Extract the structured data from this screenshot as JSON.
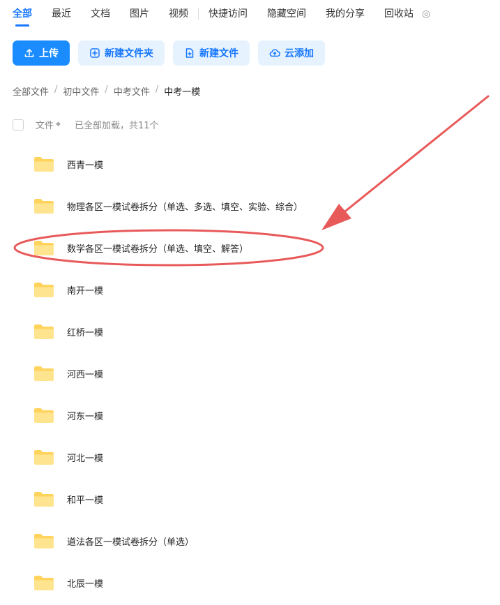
{
  "tabs": [
    {
      "label": "全部"
    },
    {
      "label": "最近"
    },
    {
      "label": "文档"
    },
    {
      "label": "图片"
    },
    {
      "label": "视频"
    },
    {
      "label": "快捷访问"
    },
    {
      "label": "隐藏空间"
    },
    {
      "label": "我的分享"
    },
    {
      "label": "回收站"
    }
  ],
  "toolbar": {
    "upload_label": "上传",
    "new_folder_label": "新建文件夹",
    "new_file_label": "新建文件",
    "cloud_add_label": "云添加"
  },
  "breadcrumb": [
    "全部文件",
    "初中文件",
    "中考文件",
    "中考一模"
  ],
  "list_header": {
    "column_label": "文件",
    "status_text": "已全部加载，共11个"
  },
  "files": [
    {
      "name": "西青一模"
    },
    {
      "name": "物理各区一模试卷拆分（单选、多选、填空、实验、综合）"
    },
    {
      "name": "数学各区一模试卷拆分（单选、填空、解答）"
    },
    {
      "name": "南开一模"
    },
    {
      "name": "红桥一模"
    },
    {
      "name": "河西一模"
    },
    {
      "name": "河东一模"
    },
    {
      "name": "河北一模"
    },
    {
      "name": "和平一模"
    },
    {
      "name": "道法各区一模试卷拆分（单选）"
    },
    {
      "name": "北辰一模"
    }
  ],
  "colors": {
    "accent": "#1677ff",
    "annotation": "#e85a5a",
    "folder": "#ffd35c"
  }
}
